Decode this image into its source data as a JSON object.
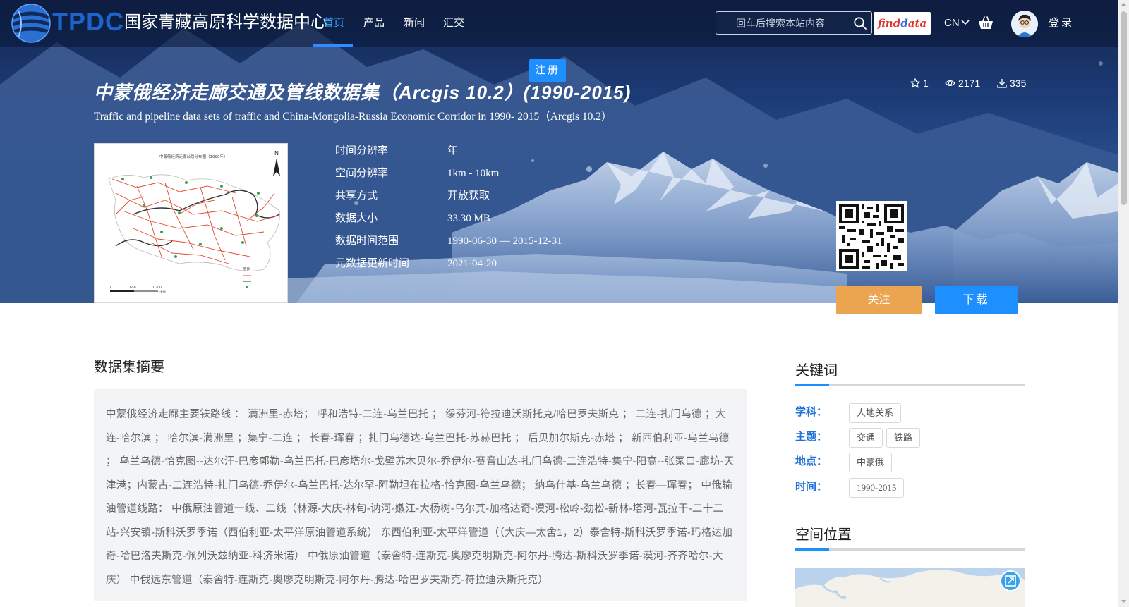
{
  "header": {
    "logo_text": "TPDC",
    "site_name": "国家青藏高原科学数据中心",
    "nav": [
      {
        "label": "首页",
        "active": true
      },
      {
        "label": "产品",
        "active": false
      },
      {
        "label": "新闻",
        "active": false
      },
      {
        "label": "汇交",
        "active": false
      }
    ],
    "search_placeholder": "回车后搜索本站内容",
    "findata_label_1": "find",
    "findata_label_2": "ata",
    "findata_d": "d",
    "language": "CN",
    "login_label": "登录",
    "accent_color": "#1e8fff"
  },
  "hero": {
    "register_label": "注册",
    "title_cn": "中蒙俄经济走廊交通及管线数据集（Arcgis 10.2）(1990-2015)",
    "title_en": "Traffic and pipeline data sets of traffic and China-Mongolia-Russia Economic Corridor in 1990- 2015（Arcgis 10.2）",
    "stats": {
      "stars": "1",
      "views": "2171",
      "downloads": "335"
    },
    "thumbnail": {
      "map_title": "中蒙俄经济走廊公路分布图（1990年）",
      "north": "N",
      "legend_title": "图例",
      "scale": [
        "0",
        "650",
        "1,300"
      ],
      "scale_unit": "千米"
    },
    "meta": [
      {
        "key": "时间分辨率",
        "value": "年"
      },
      {
        "key": "空间分辨率",
        "value": "1km - 10km"
      },
      {
        "key": "共享方式",
        "value": "开放获取"
      },
      {
        "key": "数据大小",
        "value": "33.30 MB"
      },
      {
        "key": "数据时间范围",
        "value": "1990-06-30 — 2015-12-31"
      },
      {
        "key": "元数据更新时间",
        "value": "2021-04-20"
      }
    ],
    "follow_label": "关注",
    "download_label": "下载"
  },
  "abstract": {
    "heading": "数据集摘要",
    "text": "中蒙俄经济走廊主要铁路线 ： 满洲里-赤塔； 呼和浩特-二连-乌兰巴托 ； 绥芬河-符拉迪沃斯托克/哈巴罗夫斯克 ； 二连-扎门乌德 ；大连-哈尔滨 ； 哈尔滨-满洲里 ；集宁-二连 ； 长春-珲春 ；扎门乌德达-乌兰巴托-苏赫巴托 ； 后贝加尔斯克-赤塔 ； 新西伯利亚-乌兰乌德 ； 乌兰乌德-恰克图--达尔汗-巴彦郭勒-乌兰巴托-巴彦塔尔-戈壁苏木贝尔-乔伊尔-赛音山达-扎门乌德-二连浩特-集宁-阳高--张家口-廊坊-天津港；内蒙古-二连浩特-扎门乌德-乔伊尔-乌兰巴托-达尔罕-阿勒坦布拉格-恰克图-乌兰乌德； 纳乌什基-乌兰乌德 ；长春—珲春； 中俄输油管道线路： 中俄原油管道一线、二线（林源-大庆-林甸-讷河-嫩江-大杨树-乌尔其-加格达奇-漠河-松岭-劲松-新林-塔河-瓦拉干-二十二站-兴安镇-斯科沃罗季诺（西伯利亚-太平洋原油管道系统） 东西伯利亚-太平洋管道（（大庆—太舍1，2）泰舍特-斯科沃罗季诺-玛格达加奇-哈巴洛夫斯克-佩列沃兹纳亚-科济米诺） 中俄原油管道（泰舍特-连斯克-奥廖克明斯克-阿尔丹-腾达-斯科沃罗季诺-漠河-齐齐哈尔-大庆） 中俄远东管道（泰舍特-连斯克-奥廖克明斯克-阿尔丹-腾达-哈巴罗夫斯克-符拉迪沃斯托克）"
  },
  "keywords": {
    "heading": "关键词",
    "groups": [
      {
        "label": "学科：",
        "tags": [
          "人地关系"
        ]
      },
      {
        "label": "主题：",
        "tags": [
          "交通",
          "铁路"
        ]
      },
      {
        "label": "地点：",
        "tags": [
          "中蒙俄"
        ]
      },
      {
        "label": "时间：",
        "tags": [
          "1990-2015"
        ]
      }
    ]
  },
  "spatial": {
    "heading": "空间位置"
  },
  "icons": {
    "search": "search-icon",
    "cart": "cart-icon",
    "star": "star-icon",
    "eye": "eye-icon",
    "download": "download-icon",
    "qr": "qr-code-icon",
    "expand": "expand-map-icon"
  }
}
